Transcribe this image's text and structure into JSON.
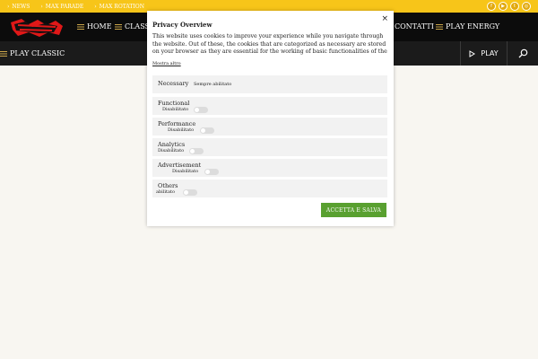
{
  "topbar": {
    "links": [
      "NEWS",
      "MAX PARADE",
      "MAX ROTATION"
    ],
    "social_icons": [
      "facebook-icon",
      "youtube-icon",
      "twitter-icon",
      "instagram-icon"
    ],
    "background": "#f7c519"
  },
  "nav": {
    "items": [
      "HOME",
      "CLASSI",
      "CONTATTI",
      "PLAY ENERGY"
    ],
    "sub_items": [
      "PLAY CLASSIC"
    ],
    "play_label": "PLAY",
    "background": "#0c0c0c"
  },
  "modal": {
    "close_symbol": "×",
    "title": "Privacy Overview",
    "text": "This website uses cookies to improve your experience while you navigate through the website. Out of these, the cookies that are categorized as necessary are stored on your browser as they are essential for the working of basic functionalities of the",
    "show_more": "Mostra altro",
    "categories": [
      {
        "name": "Necessary",
        "status": "Sempre abilitato",
        "toggle": false
      },
      {
        "name": "Functional",
        "status": "Disabilitato",
        "toggle": true
      },
      {
        "name": "Performance",
        "status": "Disabilitato",
        "toggle": true
      },
      {
        "name": "Analytics",
        "status": "Disabilitato",
        "toggle": true
      },
      {
        "name": "Advertisement",
        "status": "Disabilitato",
        "toggle": true
      },
      {
        "name": "Others",
        "status": "abilitato",
        "toggle": true
      }
    ],
    "accept_label": "ACCETTA E SALVA",
    "accept_color": "#59a030"
  }
}
